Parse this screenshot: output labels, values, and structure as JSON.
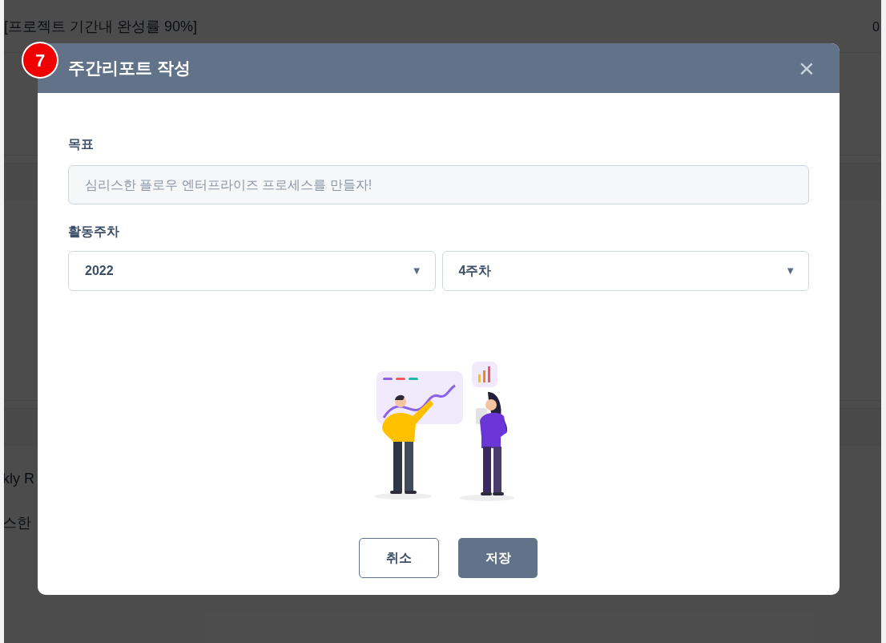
{
  "background_page": {
    "heading": "[프로젝트 기간내 완성률 90%]",
    "value_cut": "0",
    "row_text_1": "kly R",
    "row_text_2": "스한"
  },
  "step_badge": "7",
  "modal": {
    "title": "주간리포트 작성",
    "close": "×",
    "goal": {
      "label": "목표",
      "placeholder": "심리스한 플로우 엔터프라이즈 프로세스를 만들자!"
    },
    "week": {
      "label": "활동주차",
      "selects": [
        {
          "value": "2022",
          "caret": "▼"
        },
        {
          "value": "4주차",
          "caret": "▼"
        }
      ]
    },
    "buttons": [
      {
        "label": "취소",
        "kind": "secondary"
      },
      {
        "label": "저장",
        "kind": "primary"
      }
    ]
  }
}
